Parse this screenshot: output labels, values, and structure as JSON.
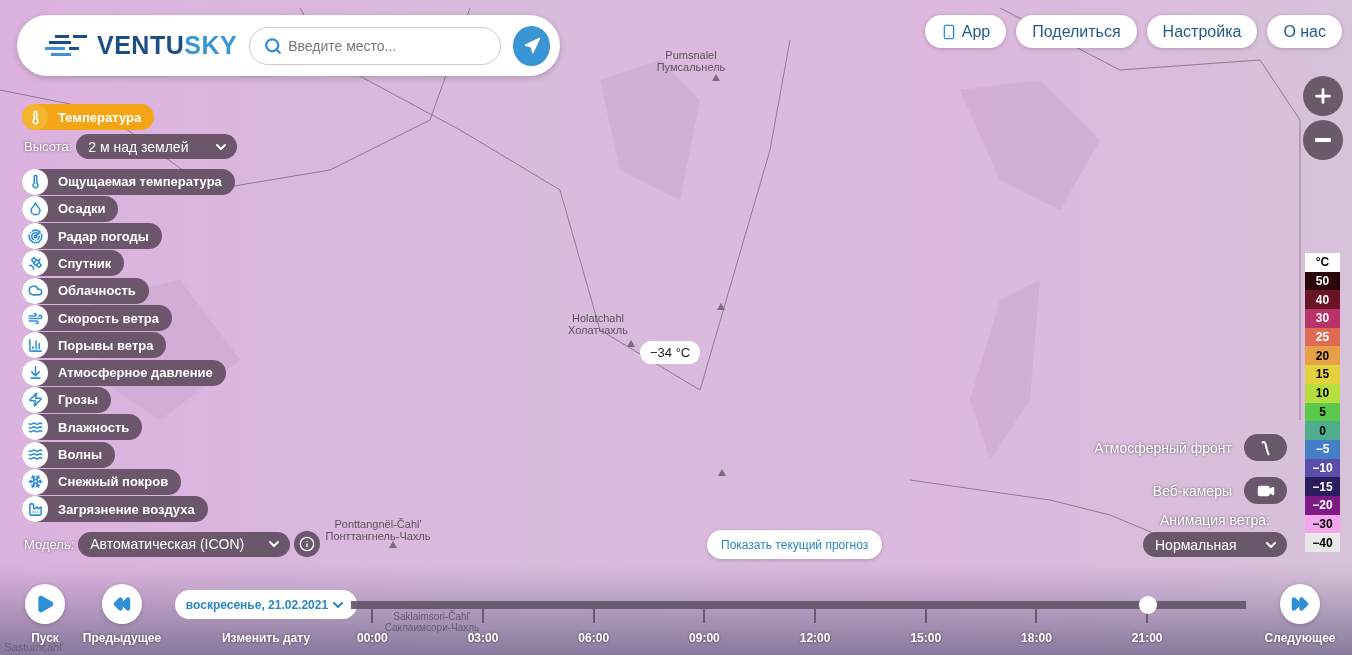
{
  "logo": {
    "primary": "VENTU",
    "accent": "SKY"
  },
  "search": {
    "placeholder": "Введите место..."
  },
  "top_menu": [
    {
      "label": "App",
      "kind": "app"
    },
    {
      "label": "Поделиться",
      "kind": "plain"
    },
    {
      "label": "Настройка",
      "kind": "plain"
    },
    {
      "label": "О нас",
      "kind": "plain"
    }
  ],
  "layers": [
    {
      "label": "Температура",
      "selected": true
    },
    {
      "label": "Ощущаемая температура",
      "selected": false
    },
    {
      "label": "Осадки",
      "selected": false
    },
    {
      "label": "Радар погоды",
      "selected": false
    },
    {
      "label": "Спутник",
      "selected": false
    },
    {
      "label": "Облачность",
      "selected": false
    },
    {
      "label": "Скорость ветра",
      "selected": false
    },
    {
      "label": "Порывы ветра",
      "selected": false
    },
    {
      "label": "Атмосферное давление",
      "selected": false
    },
    {
      "label": "Грозы",
      "selected": false
    },
    {
      "label": "Влажность",
      "selected": false
    },
    {
      "label": "Волны",
      "selected": false
    },
    {
      "label": "Снежный покров",
      "selected": false
    },
    {
      "label": "Загрязнение воздуха",
      "selected": false
    }
  ],
  "height": {
    "label": "Высота:",
    "value": "2 м над землей"
  },
  "model": {
    "label": "Модель:",
    "value": "Автоматическая (ICON)"
  },
  "map_labels": [
    {
      "latin": "Pumsnalel",
      "cyrillic": "Пумсальнель"
    },
    {
      "latin": "Holatchahl",
      "cyrillic": "Холатчахль"
    },
    {
      "latin": "Ponttangnël-Čahl'",
      "cyrillic": "Понттангнель-Чахль"
    },
    {
      "latin": "Saklaimsori-Čahl'",
      "cyrillic": "Саклаимсори-Чахль"
    },
    {
      "latin": "Sastumčahl'"
    }
  ],
  "temperature_tooltip": "−34 °C",
  "show_current_button": "Показать текущий прогноз",
  "overlays": [
    {
      "label": "Атмосферный фронт",
      "kind": "front"
    },
    {
      "label": "Веб-камеры",
      "kind": "camera"
    }
  ],
  "wind_animation": {
    "label": "Анимация ветра:",
    "value": "Нормальная"
  },
  "legend": {
    "unit": "°C",
    "steps": [
      {
        "value": "50",
        "color": "#2a0509"
      },
      {
        "value": "40",
        "color": "#6b1326"
      },
      {
        "value": "30",
        "color": "#b83468"
      },
      {
        "value": "25",
        "color": "#e06b55"
      },
      {
        "value": "20",
        "color": "#e6a048"
      },
      {
        "value": "15",
        "color": "#e4d23c"
      },
      {
        "value": "10",
        "color": "#b6de3c"
      },
      {
        "value": "5",
        "color": "#5bc94c"
      },
      {
        "value": "0",
        "color": "#4fae8e"
      },
      {
        "value": "−5",
        "color": "#447ec4"
      },
      {
        "value": "−10",
        "color": "#5a4fa8"
      },
      {
        "value": "−15",
        "color": "#2a1c5e"
      },
      {
        "value": "−20",
        "color": "#7e1a84"
      },
      {
        "value": "−30",
        "color": "#f2a6ec"
      },
      {
        "value": "−40",
        "color": "#e8e8e8"
      }
    ]
  },
  "player": {
    "play": "Пуск",
    "previous": "Предыдущее",
    "next": "Следующее",
    "date": "воскресенье, 21.02.2021",
    "change_date": "Изменить дату",
    "level": 0.89,
    "times": [
      "00:00",
      "03:00",
      "06:00",
      "09:00",
      "12:00",
      "15:00",
      "18:00",
      "21:00"
    ]
  }
}
